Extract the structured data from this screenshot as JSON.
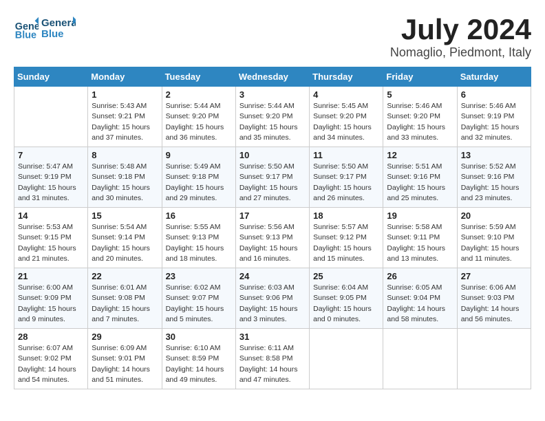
{
  "header": {
    "logo_line1": "General",
    "logo_line2": "Blue",
    "month_title": "July 2024",
    "location": "Nomaglio, Piedmont, Italy"
  },
  "weekdays": [
    "Sunday",
    "Monday",
    "Tuesday",
    "Wednesday",
    "Thursday",
    "Friday",
    "Saturday"
  ],
  "weeks": [
    [
      {
        "day": "",
        "info": ""
      },
      {
        "day": "1",
        "info": "Sunrise: 5:43 AM\nSunset: 9:21 PM\nDaylight: 15 hours\nand 37 minutes."
      },
      {
        "day": "2",
        "info": "Sunrise: 5:44 AM\nSunset: 9:20 PM\nDaylight: 15 hours\nand 36 minutes."
      },
      {
        "day": "3",
        "info": "Sunrise: 5:44 AM\nSunset: 9:20 PM\nDaylight: 15 hours\nand 35 minutes."
      },
      {
        "day": "4",
        "info": "Sunrise: 5:45 AM\nSunset: 9:20 PM\nDaylight: 15 hours\nand 34 minutes."
      },
      {
        "day": "5",
        "info": "Sunrise: 5:46 AM\nSunset: 9:20 PM\nDaylight: 15 hours\nand 33 minutes."
      },
      {
        "day": "6",
        "info": "Sunrise: 5:46 AM\nSunset: 9:19 PM\nDaylight: 15 hours\nand 32 minutes."
      }
    ],
    [
      {
        "day": "7",
        "info": "Sunrise: 5:47 AM\nSunset: 9:19 PM\nDaylight: 15 hours\nand 31 minutes."
      },
      {
        "day": "8",
        "info": "Sunrise: 5:48 AM\nSunset: 9:18 PM\nDaylight: 15 hours\nand 30 minutes."
      },
      {
        "day": "9",
        "info": "Sunrise: 5:49 AM\nSunset: 9:18 PM\nDaylight: 15 hours\nand 29 minutes."
      },
      {
        "day": "10",
        "info": "Sunrise: 5:50 AM\nSunset: 9:17 PM\nDaylight: 15 hours\nand 27 minutes."
      },
      {
        "day": "11",
        "info": "Sunrise: 5:50 AM\nSunset: 9:17 PM\nDaylight: 15 hours\nand 26 minutes."
      },
      {
        "day": "12",
        "info": "Sunrise: 5:51 AM\nSunset: 9:16 PM\nDaylight: 15 hours\nand 25 minutes."
      },
      {
        "day": "13",
        "info": "Sunrise: 5:52 AM\nSunset: 9:16 PM\nDaylight: 15 hours\nand 23 minutes."
      }
    ],
    [
      {
        "day": "14",
        "info": "Sunrise: 5:53 AM\nSunset: 9:15 PM\nDaylight: 15 hours\nand 21 minutes."
      },
      {
        "day": "15",
        "info": "Sunrise: 5:54 AM\nSunset: 9:14 PM\nDaylight: 15 hours\nand 20 minutes."
      },
      {
        "day": "16",
        "info": "Sunrise: 5:55 AM\nSunset: 9:13 PM\nDaylight: 15 hours\nand 18 minutes."
      },
      {
        "day": "17",
        "info": "Sunrise: 5:56 AM\nSunset: 9:13 PM\nDaylight: 15 hours\nand 16 minutes."
      },
      {
        "day": "18",
        "info": "Sunrise: 5:57 AM\nSunset: 9:12 PM\nDaylight: 15 hours\nand 15 minutes."
      },
      {
        "day": "19",
        "info": "Sunrise: 5:58 AM\nSunset: 9:11 PM\nDaylight: 15 hours\nand 13 minutes."
      },
      {
        "day": "20",
        "info": "Sunrise: 5:59 AM\nSunset: 9:10 PM\nDaylight: 15 hours\nand 11 minutes."
      }
    ],
    [
      {
        "day": "21",
        "info": "Sunrise: 6:00 AM\nSunset: 9:09 PM\nDaylight: 15 hours\nand 9 minutes."
      },
      {
        "day": "22",
        "info": "Sunrise: 6:01 AM\nSunset: 9:08 PM\nDaylight: 15 hours\nand 7 minutes."
      },
      {
        "day": "23",
        "info": "Sunrise: 6:02 AM\nSunset: 9:07 PM\nDaylight: 15 hours\nand 5 minutes."
      },
      {
        "day": "24",
        "info": "Sunrise: 6:03 AM\nSunset: 9:06 PM\nDaylight: 15 hours\nand 3 minutes."
      },
      {
        "day": "25",
        "info": "Sunrise: 6:04 AM\nSunset: 9:05 PM\nDaylight: 15 hours\nand 0 minutes."
      },
      {
        "day": "26",
        "info": "Sunrise: 6:05 AM\nSunset: 9:04 PM\nDaylight: 14 hours\nand 58 minutes."
      },
      {
        "day": "27",
        "info": "Sunrise: 6:06 AM\nSunset: 9:03 PM\nDaylight: 14 hours\nand 56 minutes."
      }
    ],
    [
      {
        "day": "28",
        "info": "Sunrise: 6:07 AM\nSunset: 9:02 PM\nDaylight: 14 hours\nand 54 minutes."
      },
      {
        "day": "29",
        "info": "Sunrise: 6:09 AM\nSunset: 9:01 PM\nDaylight: 14 hours\nand 51 minutes."
      },
      {
        "day": "30",
        "info": "Sunrise: 6:10 AM\nSunset: 8:59 PM\nDaylight: 14 hours\nand 49 minutes."
      },
      {
        "day": "31",
        "info": "Sunrise: 6:11 AM\nSunset: 8:58 PM\nDaylight: 14 hours\nand 47 minutes."
      },
      {
        "day": "",
        "info": ""
      },
      {
        "day": "",
        "info": ""
      },
      {
        "day": "",
        "info": ""
      }
    ]
  ]
}
